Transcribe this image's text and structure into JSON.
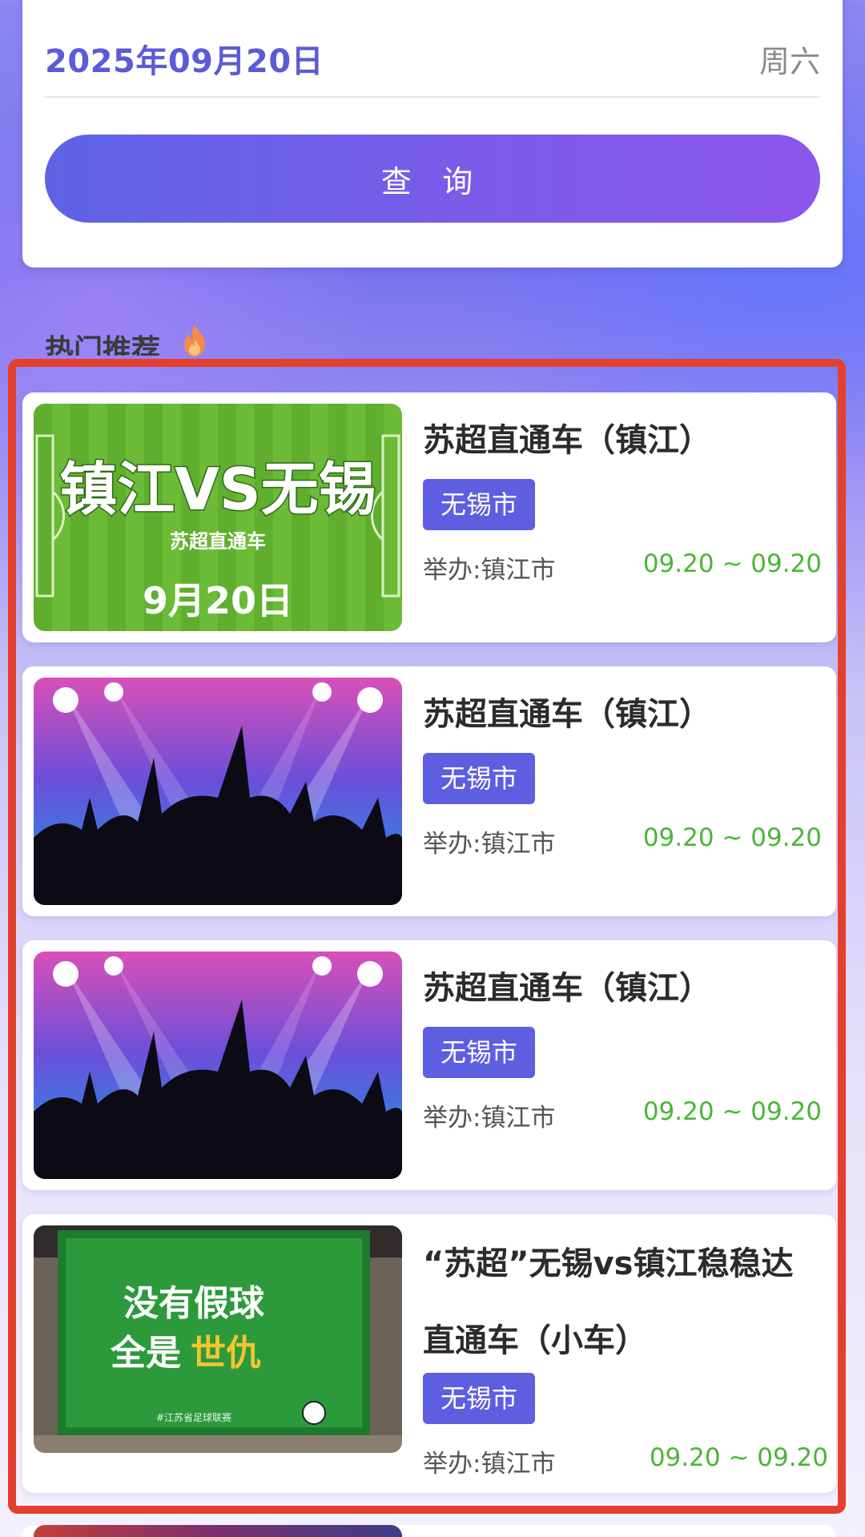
{
  "search": {
    "date": "2025年09月20日",
    "weekday": "周六",
    "query_label": "查 询"
  },
  "section": {
    "title": "热门推荐",
    "icon": "fire-icon"
  },
  "events": [
    {
      "title": "苏超直通车（镇江）",
      "city": "无锡市",
      "host": "举办:镇江市",
      "dates": "09.20 ~ 09.20",
      "image": {
        "type": "football-pitch-banner",
        "headline": "镇江VS无锡",
        "sub": "苏超直通车",
        "date": "9月20日"
      }
    },
    {
      "title": "苏超直通车（镇江）",
      "city": "无锡市",
      "host": "举办:镇江市",
      "dates": "09.20 ~ 09.20",
      "image": {
        "type": "cheering-crowd-silhouette"
      }
    },
    {
      "title": "苏超直通车（镇江）",
      "city": "无锡市",
      "host": "举办:镇江市",
      "dates": "09.20 ~ 09.20",
      "image": {
        "type": "cheering-crowd-silhouette"
      }
    },
    {
      "title": "“苏超”无锡vs镇江稳稳达直通车（小车）",
      "city": "无锡市",
      "host": "举办:镇江市",
      "dates": "09.20 ~ 09.20",
      "image": {
        "type": "billboard",
        "line1": "没有假球",
        "line2_a": "全是",
        "line2_b": "世仇",
        "caption": "#江苏省足球联赛"
      }
    }
  ],
  "colors": {
    "accent": "#5d5fe0",
    "date_green": "#4ab536",
    "highlight": "#e4402e"
  }
}
